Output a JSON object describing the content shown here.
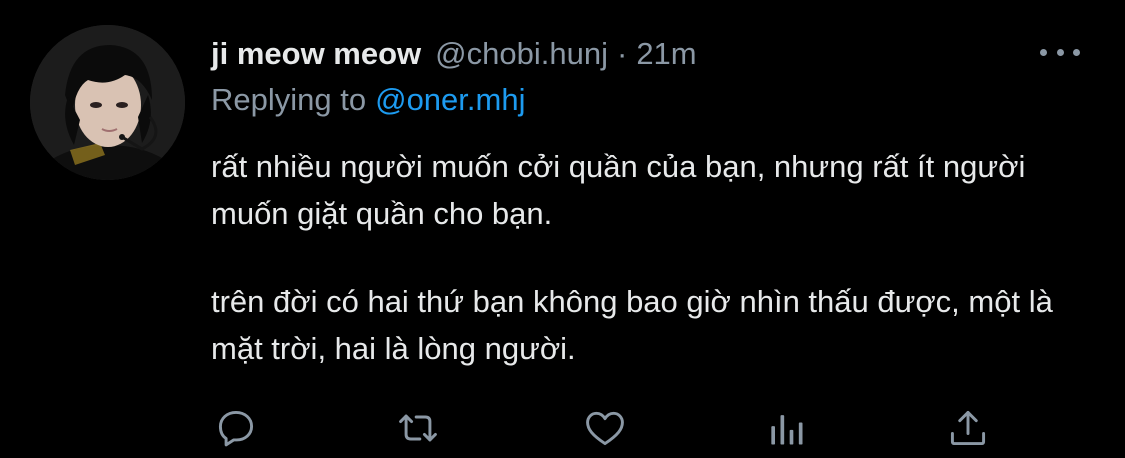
{
  "tweet": {
    "display_name": "ji meow meow",
    "handle": "@chobi.hunj",
    "separator": "·",
    "time": "21m",
    "replying_label": "Replying to",
    "replying_handle": "@oner.mhj",
    "paragraphs": [
      "rất nhiều người muốn cởi quần của bạn, nhưng rất ít người muốn giặt quần cho bạn.",
      "trên đời có hai thứ bạn không bao giờ nhìn thấu được, một là mặt trời, hai là lòng người."
    ]
  },
  "icons": {
    "more": "more-horizontal-icon",
    "reply": "reply-bubble-icon",
    "retweet": "retweet-icon",
    "like": "heart-icon",
    "analytics": "analytics-bars-icon",
    "share": "share-upload-icon"
  },
  "colors": {
    "background": "#000000",
    "primary_text": "#e7e9ea",
    "secondary_text": "#8b98a5",
    "link": "#1d9bf0"
  }
}
